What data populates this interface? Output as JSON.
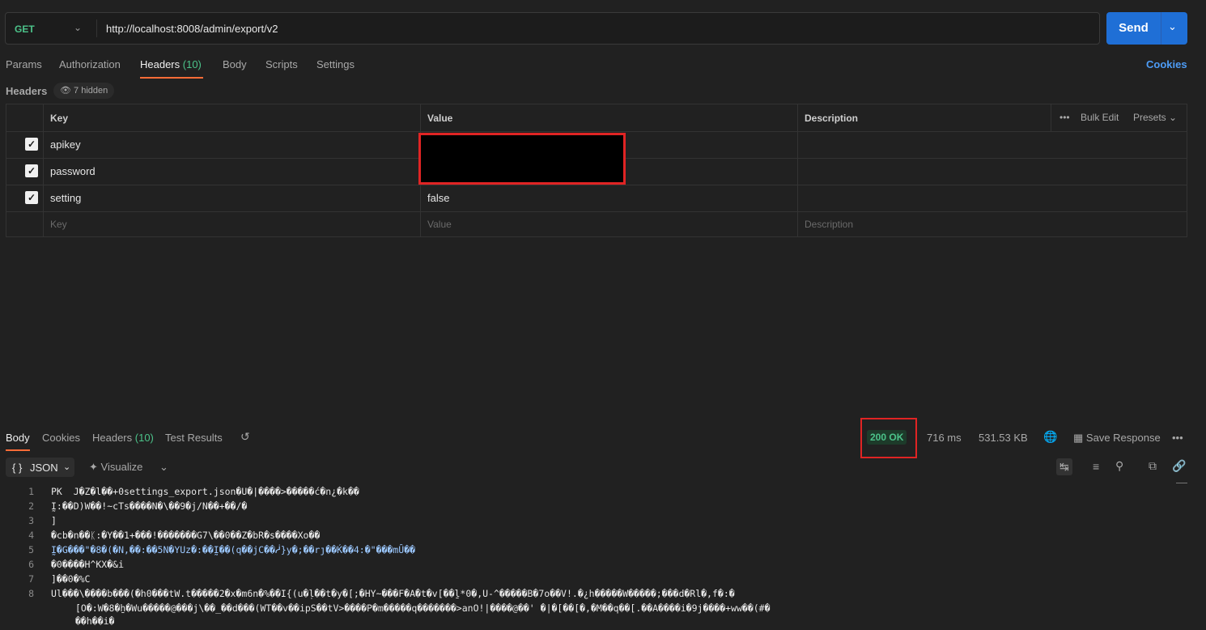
{
  "request": {
    "method": "GET",
    "url": "http://localhost:8008/admin/export/v2",
    "send_label": "Send"
  },
  "tabs": {
    "params": "Params",
    "authorization": "Authorization",
    "headers": "Headers",
    "headers_count": "(10)",
    "body": "Body",
    "scripts": "Scripts",
    "settings": "Settings",
    "cookies": "Cookies"
  },
  "headers_section": {
    "label": "Headers",
    "hidden": "7 hidden",
    "columns": {
      "key": "Key",
      "value": "Value",
      "description": "Description"
    },
    "bulk_edit": "Bulk Edit",
    "presets": "Presets",
    "rows": [
      {
        "key": "apikey",
        "value": "",
        "checked": true
      },
      {
        "key": "password",
        "value": "",
        "checked": true
      },
      {
        "key": "setting",
        "value": "false",
        "checked": true
      }
    ],
    "placeholders": {
      "key": "Key",
      "value": "Value",
      "description": "Description"
    }
  },
  "response": {
    "tabs": {
      "body": "Body",
      "cookies": "Cookies",
      "headers": "Headers",
      "headers_count": "(10)",
      "test_results": "Test Results"
    },
    "status": "200 OK",
    "time": "716 ms",
    "size": "531.53 KB",
    "save_response": "Save Response",
    "format": "JSON",
    "visualize": "Visualize",
    "line_numbers": [
      "1",
      "2",
      "3",
      "4",
      "5",
      "6",
      "7",
      "8"
    ],
    "lines": [
      "PK\u0003\u0004\u0014\u0000  J�Z�l��+0settings_export.json�U�|����>�����ć�n¿�k��",
      "Ḭ:��D)W��!~cTs����N�\\��9�j/N��+��/�",
      "]",
      "�cb�n��ᛕ:�Y��1+���!�������G7\\��0��Z�bR�s����Xo��",
      "Ḭ�G���\"�8�(�N,��:��5N�YUz�:��Ḭ��(q��jC��ᓲ}y�;��rȷ��Ḱ��4:�\"���mȖ��",
      "�0����H^KX�&i",
      "]��0�%C",
      "Ul���\\����b���(�h0���tW.t�����2�x�m6n�%��I{(u�ḷ��t�y�[;�HY~���F�A�t�v[��ḻ*0�,U-^�����B�7o��V!.�¿h�����W�����;���d�Rl�,f�:�"
    ],
    "line8_cont": "[O�:W�8�ẖ�Wu�����@���j\\��_��d���(WT��v��ipS��tV>����P�m�����q�������>anO!|����@��' �|�[��[�,�M��q��[.��A����i�9j����+ww��(#�",
    "line8_cont2": "��h��i�"
  }
}
